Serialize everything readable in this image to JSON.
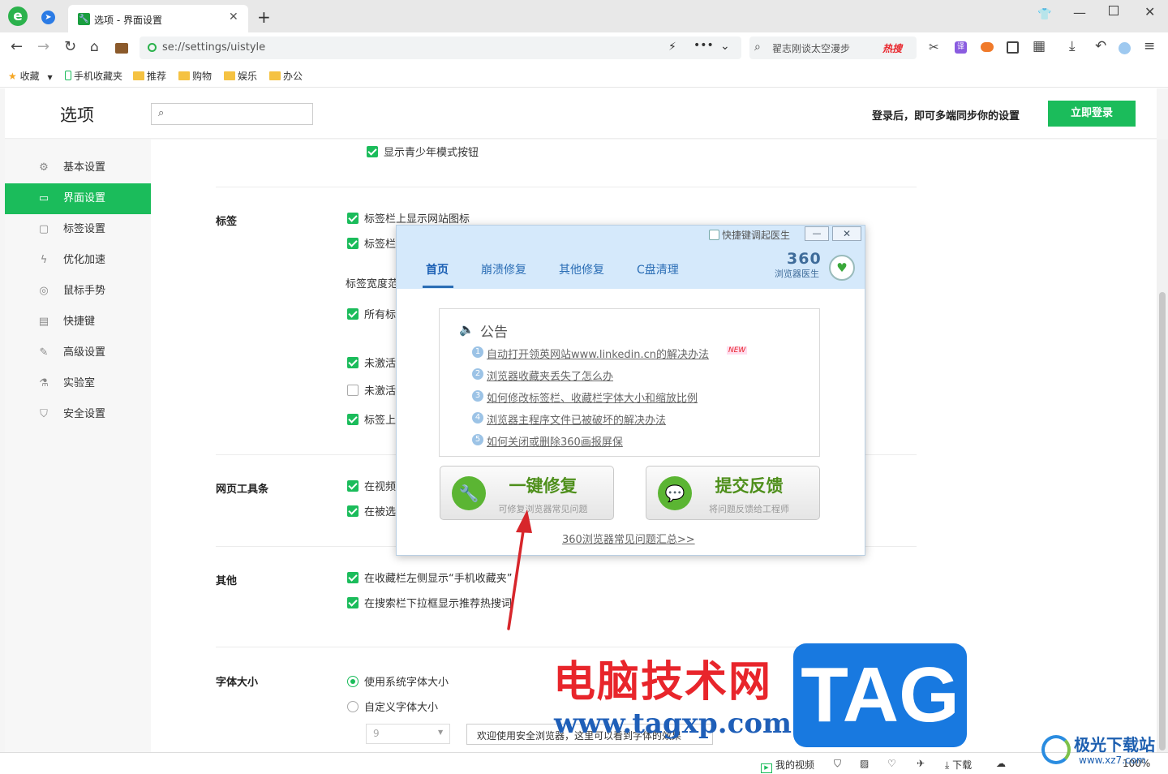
{
  "browser": {
    "tab_title": "选项 - 界面设置",
    "address": "se://settings/uistyle",
    "search_text": "翟志刚谈太空漫步",
    "hot_label": "热搜",
    "bookmarks": {
      "fav": "收藏",
      "mobile": "手机收藏夹",
      "b1": "推荐",
      "b2": "购物",
      "b3": "娱乐",
      "b4": "办公"
    }
  },
  "header": {
    "title": "选项",
    "login_hint": "登录后，即可多端同步你的设置",
    "login_button": "立即登录"
  },
  "sidebar": {
    "items": [
      {
        "label": "基本设置",
        "icon": "gear-icon"
      },
      {
        "label": "界面设置",
        "icon": "layout-icon"
      },
      {
        "label": "标签设置",
        "icon": "tab-icon"
      },
      {
        "label": "优化加速",
        "icon": "bolt-icon"
      },
      {
        "label": "鼠标手势",
        "icon": "mouse-icon"
      },
      {
        "label": "快捷键",
        "icon": "keyboard-icon"
      },
      {
        "label": "高级设置",
        "icon": "wrench-icon"
      },
      {
        "label": "实验室",
        "icon": "flask-icon"
      },
      {
        "label": "安全设置",
        "icon": "shield-icon"
      }
    ]
  },
  "settings": {
    "teen_mode": "显示青少年模式按钮",
    "tabs": {
      "heading": "标签",
      "c1": "标签栏上显示网站图标",
      "c2": "标签栏",
      "width": "标签宽度范",
      "c3": "所有标",
      "c4": "未激活",
      "c5": "未激活",
      "c6": "标签上"
    },
    "toolbar": {
      "heading": "网页工具条",
      "c1": "在视频",
      "c2": "在被选"
    },
    "other": {
      "heading": "其他",
      "c1": "在收藏栏左侧显示“手机收藏夹”",
      "c2": "在搜索栏下拉框显示推荐热搜词"
    },
    "font": {
      "heading": "字体大小",
      "r1": "使用系统字体大小",
      "r2": "自定义字体大小",
      "size": "9",
      "preview": "欢迎使用安全浏览器，这里可以看到字体的效果"
    }
  },
  "doctor": {
    "shortcut_label": "快捷键调起医生",
    "tabs": [
      "首页",
      "崩溃修复",
      "其他修复",
      "C盘清理"
    ],
    "brand_num": "360",
    "brand_name": "浏览器医生",
    "notice_title": "公告",
    "new_badge": "NEW",
    "notices": [
      "自动打开领英网站www.linkedin.cn的解决办法",
      "浏览器收藏夹丢失了怎么办",
      "如何修改标签栏、收藏栏字体大小和缩放比例",
      "浏览器主程序文件已被破坏的解决办法",
      "如何关闭或删除360画报屏保"
    ],
    "numbers": [
      "1",
      "2",
      "3",
      "4",
      "5"
    ],
    "repair_title": "一键修复",
    "repair_sub": "可修复浏览器常见问题",
    "feedback_title": "提交反馈",
    "feedback_sub": "将问题反馈给工程师",
    "faq_link": "360浏览器常见问题汇总>>"
  },
  "statusbar": {
    "video": "我的视频",
    "download": "下载",
    "zoom": "100%"
  },
  "watermark": {
    "cn": "电脑技术网",
    "url": "www.tagxp.com",
    "tag": "TAG",
    "site": "极光下载站",
    "site_url": "www.xz7.com"
  },
  "colors": {
    "accent": "#1bbc5b",
    "doctor_blue": "#d5e9fb",
    "arrow": "#d7262b"
  }
}
